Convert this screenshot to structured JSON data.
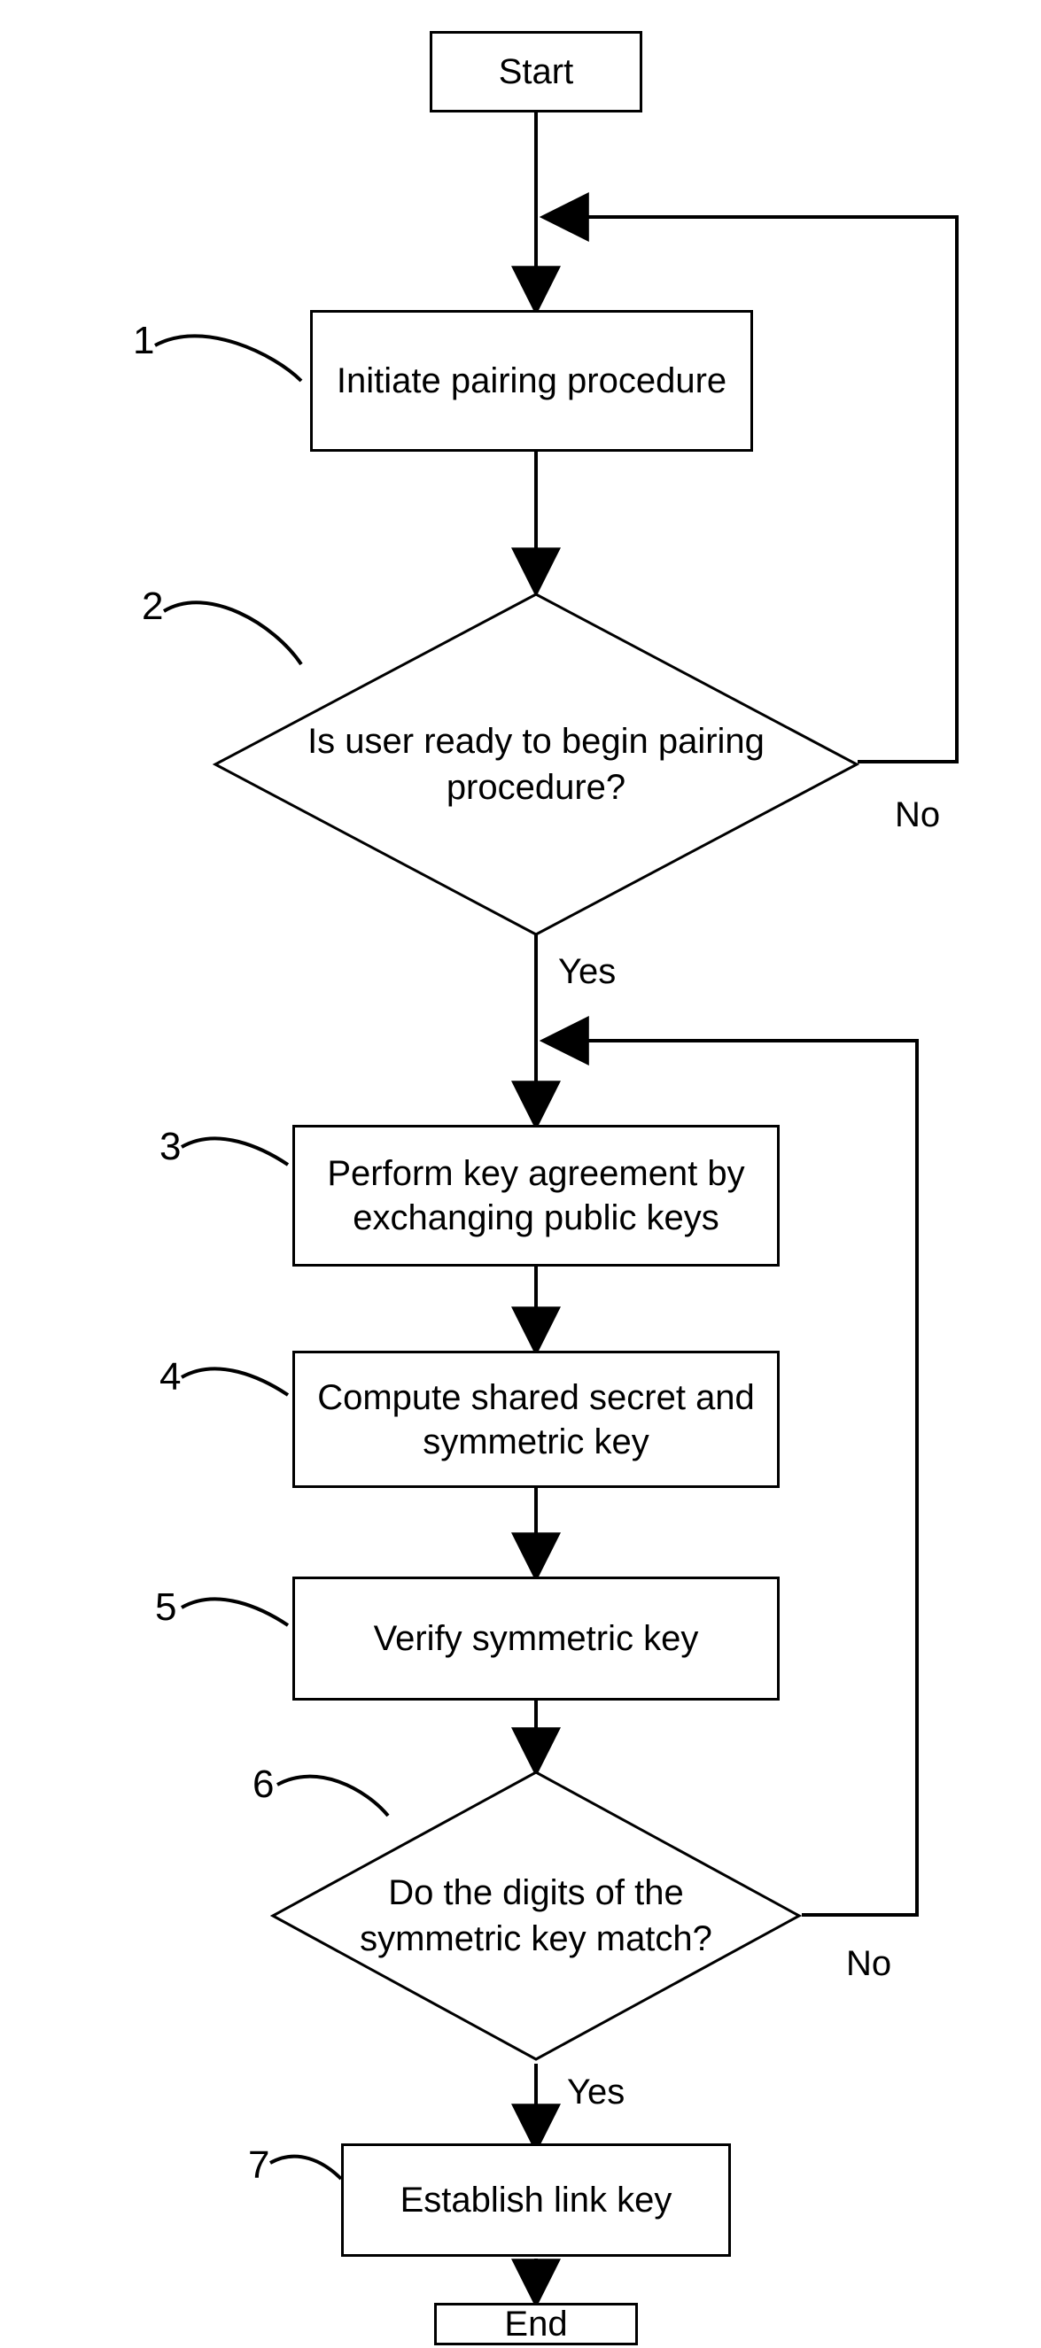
{
  "flowchart": {
    "nodes": {
      "start": {
        "label": "Start"
      },
      "n1": {
        "num": "1",
        "label": "Initiate pairing procedure"
      },
      "n2": {
        "num": "2",
        "label": "Is user ready to begin pairing procedure?"
      },
      "n3": {
        "num": "3",
        "label": "Perform key agreement by exchanging public keys"
      },
      "n4": {
        "num": "4",
        "label": "Compute shared secret and symmetric key"
      },
      "n5": {
        "num": "5",
        "label": "Verify symmetric key"
      },
      "n6": {
        "num": "6",
        "label": "Do the digits of the symmetric key match?"
      },
      "n7": {
        "num": "7",
        "label": "Establish link key"
      },
      "end": {
        "label": "End"
      }
    },
    "edges": {
      "n2_yes": "Yes",
      "n2_no": "No",
      "n6_yes": "Yes",
      "n6_no": "No"
    }
  }
}
